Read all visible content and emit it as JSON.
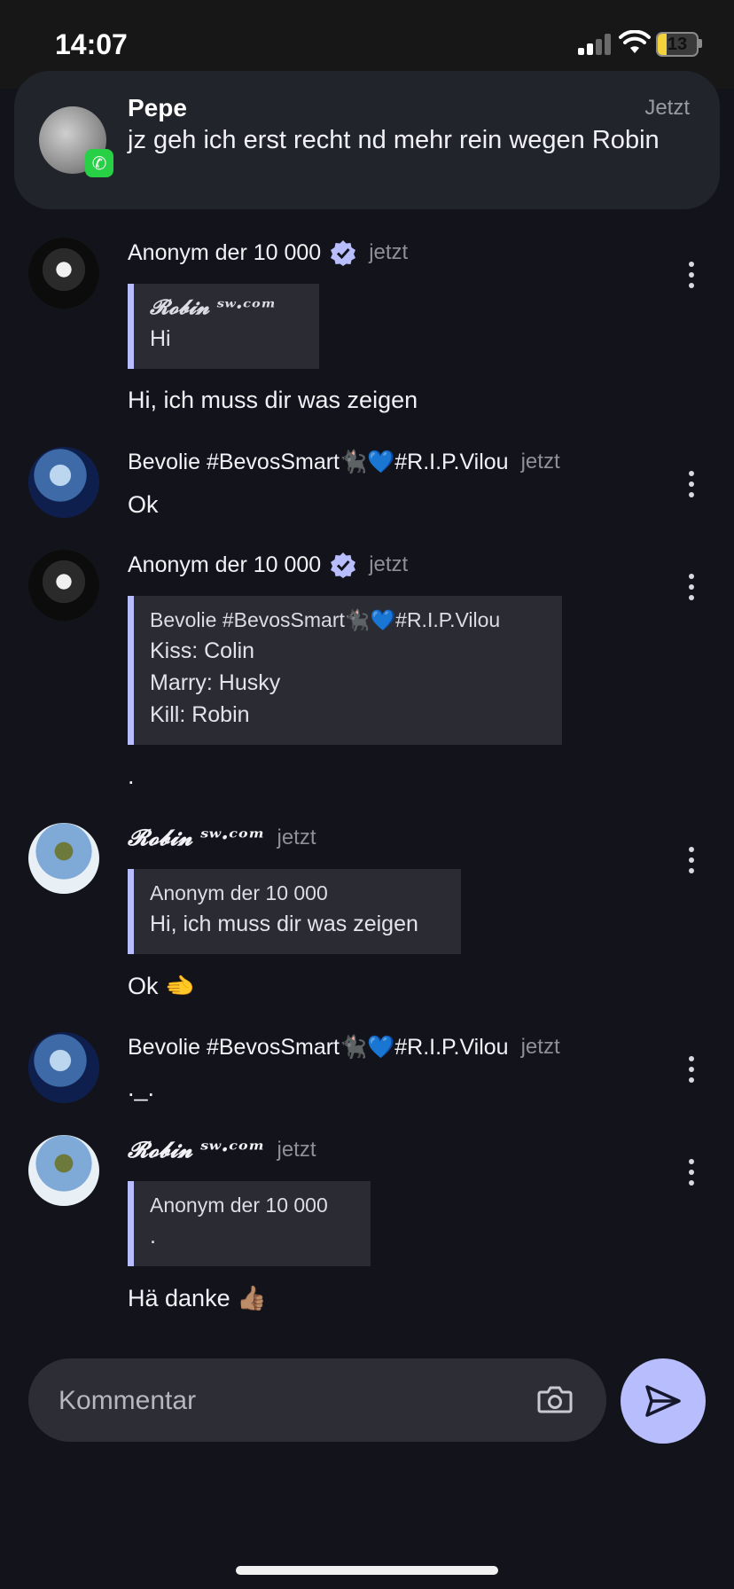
{
  "status_bar": {
    "time": "14:07",
    "battery": "13"
  },
  "notification": {
    "sender": "Pepe",
    "time": "Jetzt",
    "message": "jz geh ich erst recht nd mehr rein wegen Robin"
  },
  "comments": [
    {
      "author": "Anonym der 10 000",
      "verified": true,
      "time": "jetzt",
      "quote": {
        "author": "𝓡𝓸𝓫𝓲𝓷 ˢʷ·ᶜᵒᵐ",
        "lines": [
          "Hi"
        ]
      },
      "text": "Hi, ich muss dir was zeigen"
    },
    {
      "author": "Bevolie #BevosSmart🐈‍⬛💙#R.I.P.Vilou",
      "time": "jetzt",
      "text": "Ok"
    },
    {
      "author": "Anonym der 10 000",
      "verified": true,
      "time": "jetzt",
      "quote": {
        "author": "Bevolie #BevosSmart🐈‍⬛💙#R.I.P.Vilou",
        "lines": [
          "Kiss: Colin",
          "Marry: Husky",
          "Kill: Robin"
        ]
      },
      "text": "."
    },
    {
      "author": "𝓡𝓸𝓫𝓲𝓷 ˢʷ·ᶜᵒᵐ",
      "time": "jetzt",
      "quote": {
        "author": "Anonym der 10 000",
        "lines": [
          "Hi, ich muss dir was zeigen"
        ]
      },
      "text": "Ok 🫲"
    },
    {
      "author": "Bevolie #BevosSmart🐈‍⬛💙#R.I.P.Vilou",
      "time": "jetzt",
      "text": "._."
    },
    {
      "author": "𝓡𝓸𝓫𝓲𝓷 ˢʷ·ᶜᵒᵐ",
      "time": "jetzt",
      "quote": {
        "author": "Anonym der 10 000",
        "lines": [
          "."
        ]
      },
      "text": "Hä danke 👍🏽"
    }
  ],
  "composer": {
    "placeholder": "Kommentar"
  },
  "colors": {
    "accent": "#b8bdfd",
    "background": "#13141b",
    "quote_bg": "#2b2c33"
  }
}
